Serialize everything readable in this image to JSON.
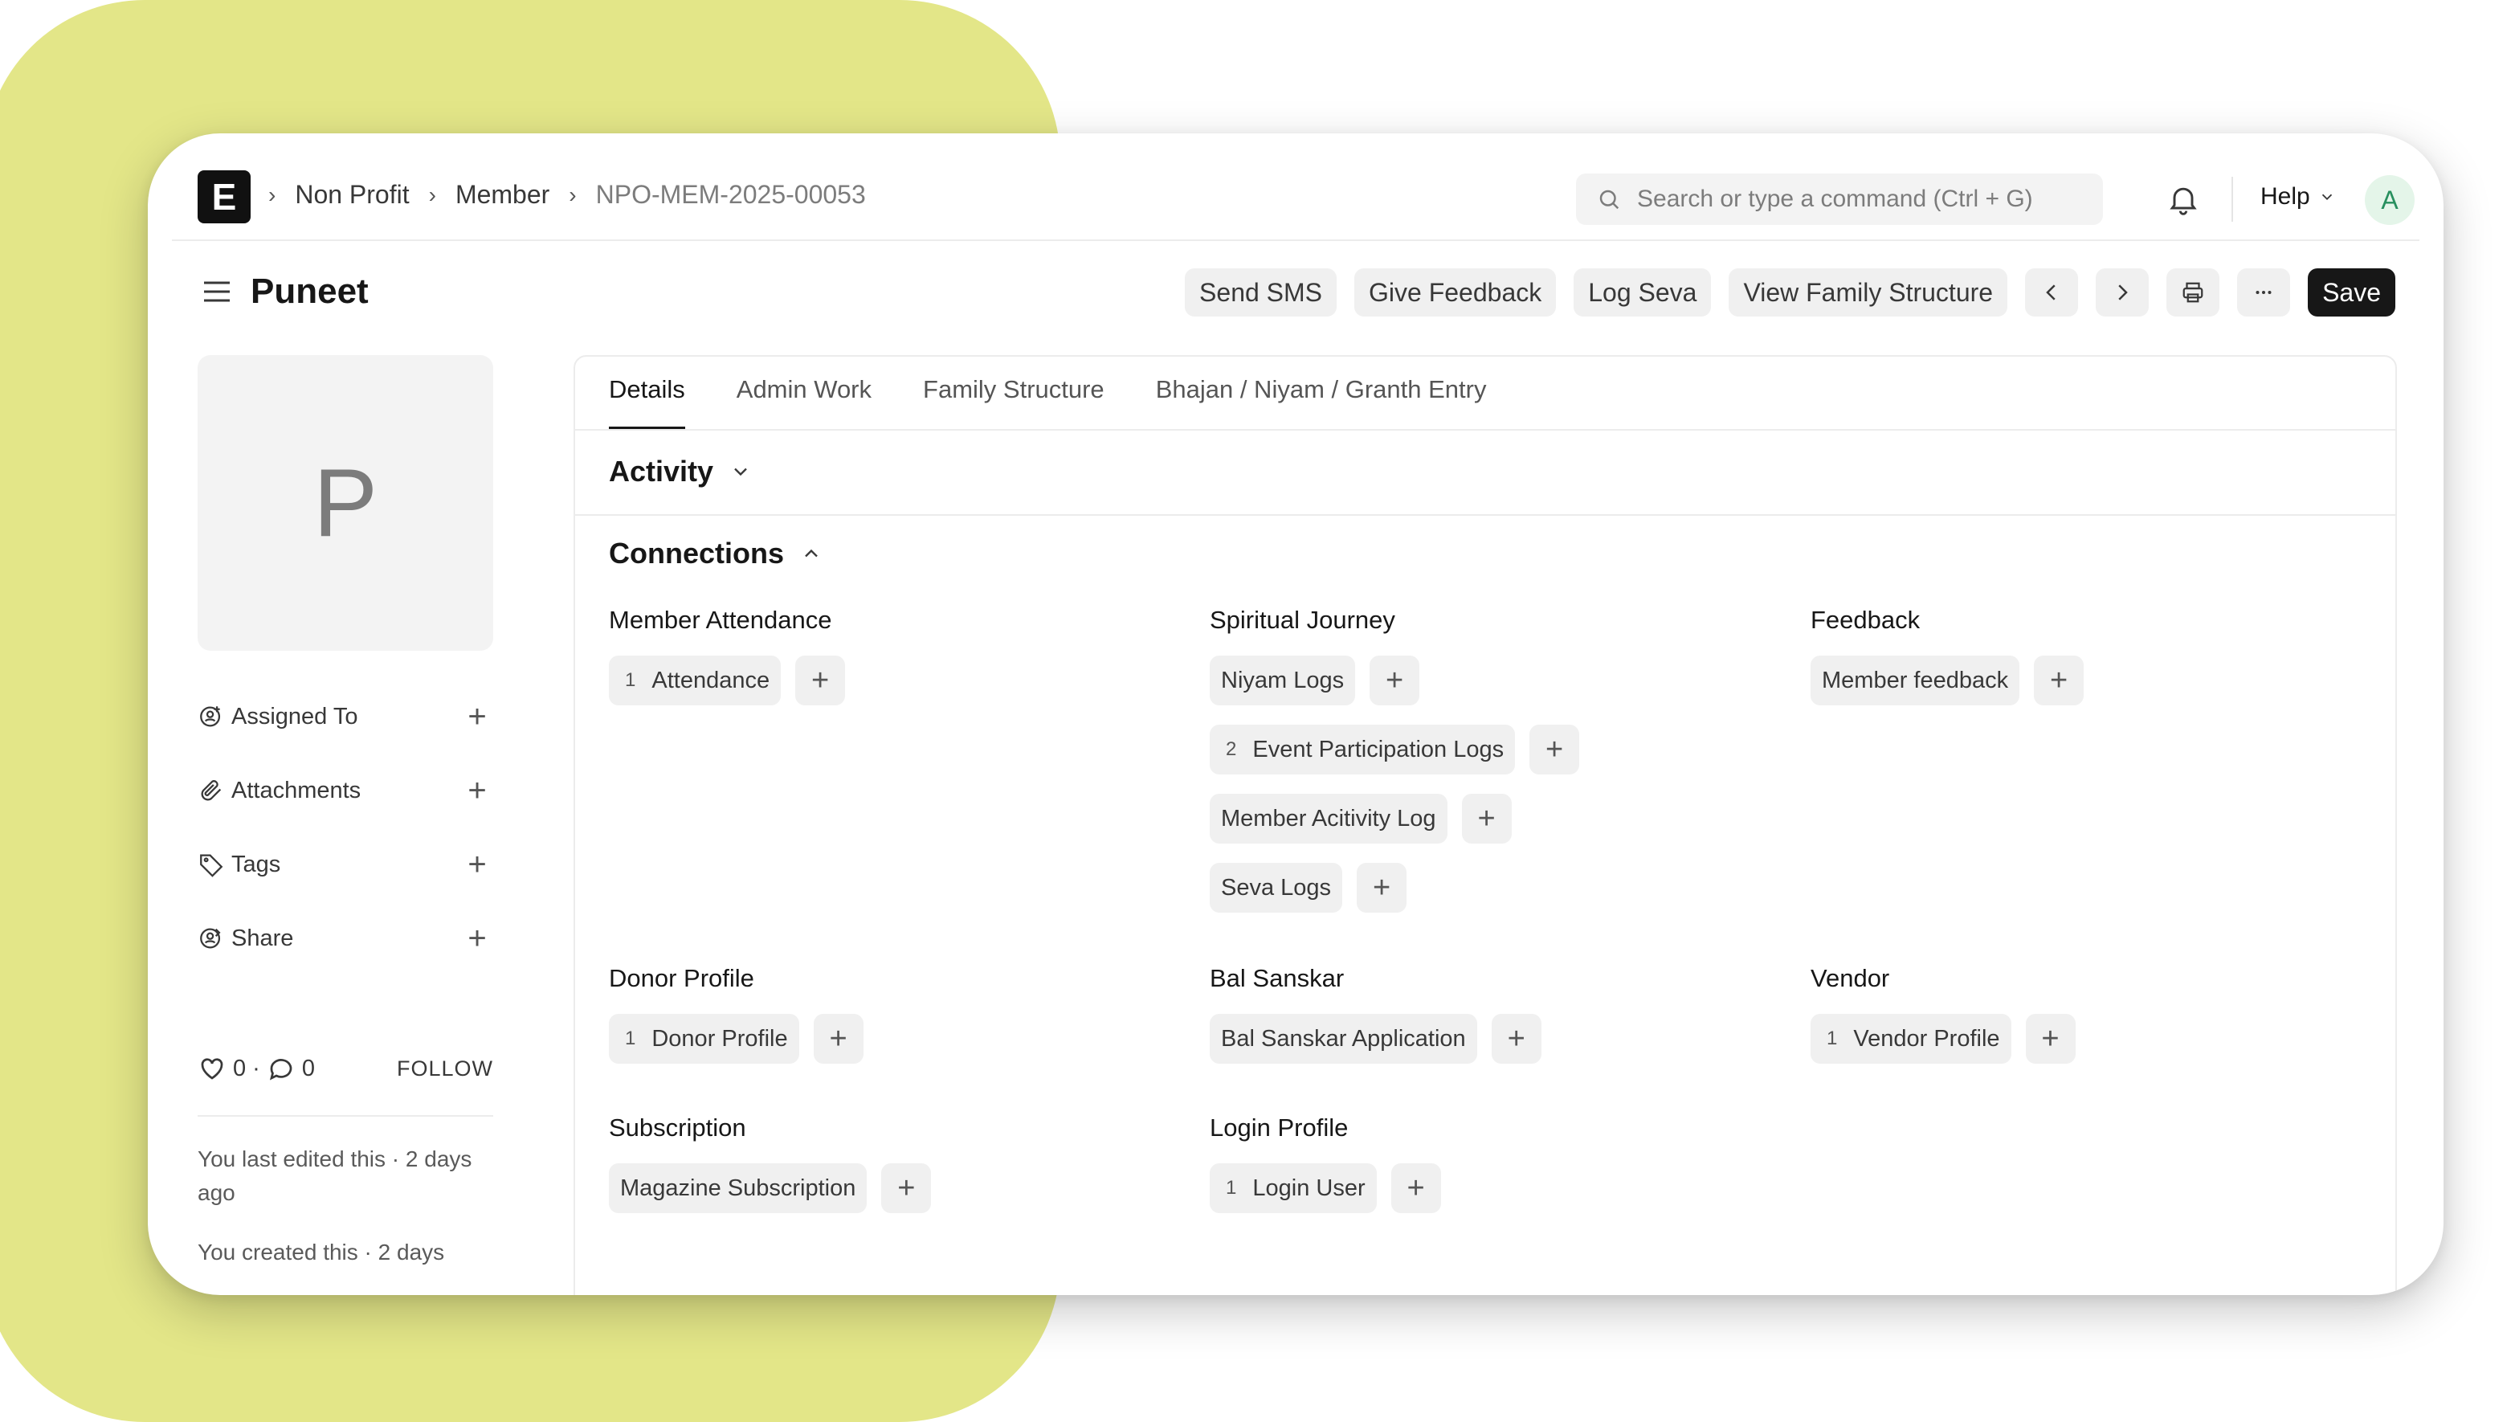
{
  "breadcrumb": {
    "items": [
      "Non Profit",
      "Member",
      "NPO-MEM-2025-00053"
    ]
  },
  "navbar": {
    "logo": "E",
    "search_placeholder": "Search or type a command (Ctrl + G)",
    "help_label": "Help",
    "avatar_letter": "A"
  },
  "page": {
    "title": "Puneet",
    "actions": {
      "send_sms": "Send SMS",
      "give_feedback": "Give Feedback",
      "log_seva": "Log Seva",
      "view_family": "View Family Structure",
      "save": "Save"
    }
  },
  "sidebar": {
    "image_letter": "P",
    "items": [
      {
        "label": "Assigned To",
        "icon": "assign-icon"
      },
      {
        "label": "Attachments",
        "icon": "paperclip-icon"
      },
      {
        "label": "Tags",
        "icon": "tag-icon"
      },
      {
        "label": "Share",
        "icon": "share-icon"
      }
    ],
    "likes": "0",
    "comments": "0",
    "follow_label": "FOLLOW",
    "last_edited": "You last edited this · 2 days ago",
    "created": "You created this · 2 days"
  },
  "tabs": [
    "Details",
    "Admin Work",
    "Family Structure",
    "Bhajan / Niyam / Granth Entry"
  ],
  "sections": {
    "activity": "Activity",
    "connections": "Connections"
  },
  "connections": {
    "member_attendance": {
      "title": "Member Attendance",
      "links": [
        {
          "count": "1",
          "label": "Attendance"
        }
      ]
    },
    "spiritual_journey": {
      "title": "Spiritual Journey",
      "links": [
        {
          "count": "",
          "label": "Niyam Logs"
        },
        {
          "count": "2",
          "label": "Event Participation Logs"
        },
        {
          "count": "",
          "label": "Member Acitivity Log"
        },
        {
          "count": "",
          "label": "Seva Logs"
        }
      ]
    },
    "feedback": {
      "title": "Feedback",
      "links": [
        {
          "count": "",
          "label": "Member feedback"
        }
      ]
    },
    "donor_profile": {
      "title": "Donor Profile",
      "links": [
        {
          "count": "1",
          "label": "Donor Profile"
        }
      ]
    },
    "bal_sanskar": {
      "title": "Bal Sanskar",
      "links": [
        {
          "count": "",
          "label": "Bal Sanskar Application"
        }
      ]
    },
    "vendor": {
      "title": "Vendor",
      "links": [
        {
          "count": "1",
          "label": "Vendor Profile"
        }
      ]
    },
    "subscription": {
      "title": "Subscription",
      "links": [
        {
          "count": "",
          "label": "Magazine Subscription"
        }
      ]
    },
    "login_profile": {
      "title": "Login Profile",
      "links": [
        {
          "count": "1",
          "label": "Login User"
        }
      ]
    }
  }
}
